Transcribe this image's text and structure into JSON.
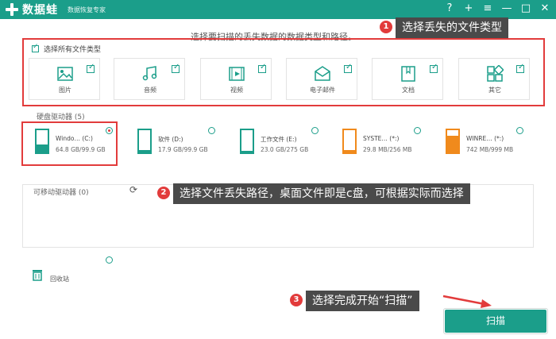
{
  "app": {
    "name": "数据蛙",
    "subtitle": "数据恢复专家"
  },
  "window_controls": [
    {
      "name": "help",
      "glyph": "?"
    },
    {
      "name": "plus",
      "glyph": "+"
    },
    {
      "name": "menu",
      "glyph": "≡"
    },
    {
      "name": "minimize",
      "glyph": "—"
    },
    {
      "name": "maximize",
      "glyph": "□"
    },
    {
      "name": "close",
      "glyph": "✕"
    }
  ],
  "main": {
    "prompt": "选择要扫描的丢失数据的数据类型和路径。",
    "select_all_label": "选择所有文件类型",
    "file_types": [
      {
        "label": "图片",
        "icon": "image-icon",
        "checked": true
      },
      {
        "label": "音频",
        "icon": "music-icon",
        "checked": true
      },
      {
        "label": "视频",
        "icon": "video-icon",
        "checked": true
      },
      {
        "label": "电子邮件",
        "icon": "mail-icon",
        "checked": true
      },
      {
        "label": "文档",
        "icon": "document-icon",
        "checked": true
      },
      {
        "label": "其它",
        "icon": "other-icon",
        "checked": true
      }
    ],
    "hard_drives_title": "硬盘驱动器 (5)",
    "drives": [
      {
        "name": "Windo… (C:)",
        "size": "64.8 GB/99.9 GB",
        "selected": true,
        "used": 0.65,
        "color": "#1b9e8a"
      },
      {
        "name": "软件 (D:)",
        "size": "17.9 GB/99.9 GB",
        "selected": false,
        "used": 0.18,
        "color": "#1b9e8a"
      },
      {
        "name": "工作文件 (E:)",
        "size": "23.0 GB/275 GB",
        "selected": false,
        "used": 0.08,
        "color": "#1b9e8a"
      },
      {
        "name": "SYSTE… (*:)",
        "size": "29.8 MB/256 MB",
        "selected": false,
        "used": 0.12,
        "color": "#f08a1c"
      },
      {
        "name": "WINRE… (*:)",
        "size": "742 MB/999 MB",
        "selected": false,
        "used": 0.74,
        "color": "#f08a1c"
      }
    ],
    "removable_title": "可移动驱动器 (0)",
    "recycle_label": "回收站",
    "scan_button": "扫描"
  },
  "callouts": [
    {
      "num": "1",
      "text": "选择丢失的文件类型"
    },
    {
      "num": "2",
      "text": "选择文件丢失路径，桌面文件即是c盘，可根据实际而选择"
    },
    {
      "num": "3",
      "text": "选择完成开始“扫描”"
    }
  ],
  "colors": {
    "accent": "#1b9e8a",
    "highlight": "#e23b3b",
    "warning": "#f08a1c",
    "callout_bg": "#4a4a4a"
  }
}
